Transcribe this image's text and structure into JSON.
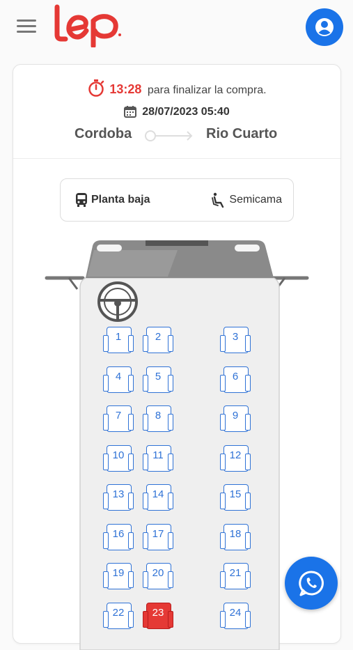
{
  "header": {
    "logo_text": "lep",
    "menu_icon": "hamburger-menu-icon",
    "user_icon": "user-account-icon",
    "brand_color": "#e53935",
    "accent_color": "#1a73e8"
  },
  "purchase": {
    "timer_icon": "stopwatch-icon",
    "timer_value": "13:28",
    "timer_text": "para finalizar la compra.",
    "calendar_icon": "calendar-icon",
    "departure": "28/07/2023 05:40",
    "origin": "Cordoba",
    "destination": "Rio Cuarto"
  },
  "deck": {
    "bus_icon": "bus-icon",
    "label": "Planta baja",
    "seat_icon": "reclining-seat-icon",
    "seat_type": "Semicama"
  },
  "seats": [
    {
      "number": "1"
    },
    {
      "number": "2"
    },
    {
      "number": "3"
    },
    {
      "number": "4"
    },
    {
      "number": "5"
    },
    {
      "number": "6"
    },
    {
      "number": "7"
    },
    {
      "number": "8"
    },
    {
      "number": "9"
    },
    {
      "number": "10"
    },
    {
      "number": "11"
    },
    {
      "number": "12"
    },
    {
      "number": "13"
    },
    {
      "number": "14"
    },
    {
      "number": "15"
    },
    {
      "number": "16"
    },
    {
      "number": "17"
    },
    {
      "number": "18"
    },
    {
      "number": "19"
    },
    {
      "number": "20"
    },
    {
      "number": "21"
    },
    {
      "number": "22"
    },
    {
      "number": "23",
      "selected": true
    },
    {
      "number": "24"
    }
  ],
  "whatsapp_icon": "whatsapp-icon"
}
